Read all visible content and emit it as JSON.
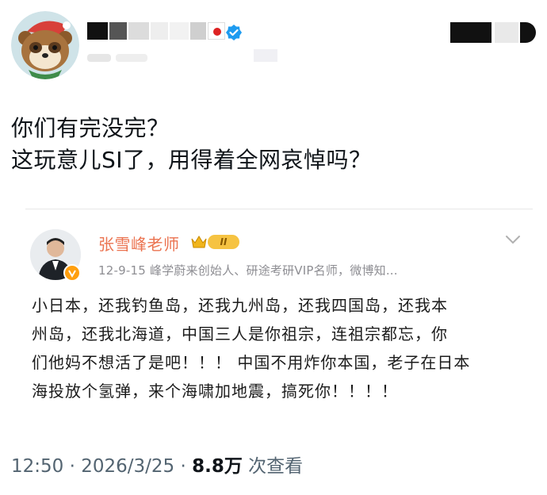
{
  "tweet": {
    "lines": [
      "你们有完没完？",
      "这玩意儿SI了，用得着全网哀悼吗？"
    ]
  },
  "quote": {
    "author_name": "张雪峰老师",
    "level_badge": "II",
    "meta": "12-9-15   峰学蔚来创始人、研途考研VIP名师，微博知...",
    "body_lines": [
      "小日本，还我钓鱼岛，还我九州岛，还我四国岛，还我本",
      "州岛，还我北海道，中国三人是你祖宗，连祖宗都忘，你",
      "们他妈不想活了是吧！！！ 中国不用炸你本国，老子在日本",
      "海投放个氢弹，来个海啸加地震，搞死你！！！！"
    ]
  },
  "footer": {
    "time": "12:50",
    "separator": "·",
    "date": "2026/3/25",
    "views_count": "8.8万",
    "views_label": "次查看"
  },
  "colors": {
    "accent_name": "#eb7350",
    "verified_blue": "#1d9bf0",
    "badge_gold": "#f6c342"
  },
  "icons": {
    "verified": "verified-badge-icon",
    "crown": "crown-icon",
    "chevron": "chevron-down-icon"
  }
}
